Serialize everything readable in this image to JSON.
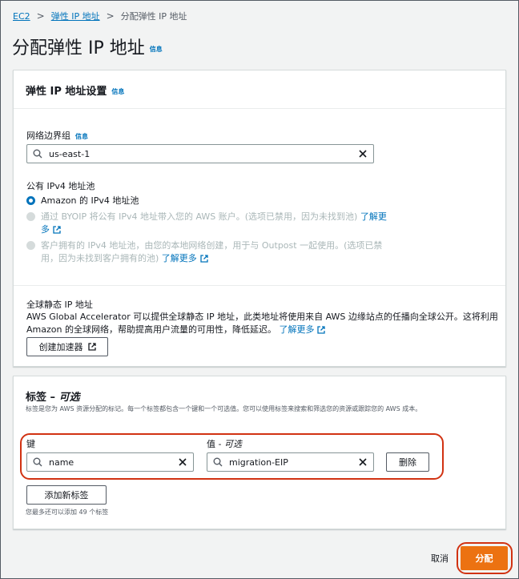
{
  "breadcrumb": {
    "root": "EC2",
    "parent": "弹性 IP 地址",
    "current": "分配弹性 IP 地址"
  },
  "page": {
    "title": "分配弹性 IP 地址",
    "info": "信息"
  },
  "settings": {
    "header": "弹性 IP 地址设置",
    "info": "信息",
    "border_group": {
      "label": "网络边界组",
      "info": "信息",
      "value": "us-east-1"
    },
    "ipv4_pool": {
      "label": "公有 IPv4 地址池",
      "opt1": "Amazon 的 IPv4 地址池",
      "opt2_line1": "通过 BYOIP 将公有 IPv4 地址带入您的 AWS 账户。(选项已禁用，因为未找到池)",
      "opt2_link_a": "了解更",
      "opt2_link_b": "多",
      "opt3_line1": "客户拥有的 IPv4 地址池，由您的本地网络创建，用于与 Outpost 一起使用。(选项已禁",
      "opt3_line2": "用，因为未找到客户拥有的池)",
      "opt3_link": "了解更多"
    },
    "global": {
      "label": "全球静态 IP 地址",
      "desc1": "AWS Global Accelerator 可以提供全球静态 IP 地址，此类地址将使用来自 AWS 边缘站点的任播向全球公开。这将利用",
      "desc2": "Amazon 的全球网络，帮助提高用户流量的可用性，降低延迟。",
      "link": "了解更多",
      "button": "创建加速器"
    }
  },
  "tags": {
    "header_main": "标签 – ",
    "header_opt": "可选",
    "desc": "标签是您为 AWS 资源分配的标记。每一个标签都包含一个键和一个可选值。您可以使用标签来搜索和筛选您的资源或跟踪您的 AWS 成本。",
    "key_label": "键",
    "value_label_main": "值 - ",
    "value_label_opt": "可选",
    "key_value": "name",
    "value_value": "migration-EIP",
    "remove": "删除",
    "add": "添加新标签",
    "limit": "您最多还可以添加 49 个标签"
  },
  "footer": {
    "cancel": "取消",
    "submit": "分配"
  }
}
